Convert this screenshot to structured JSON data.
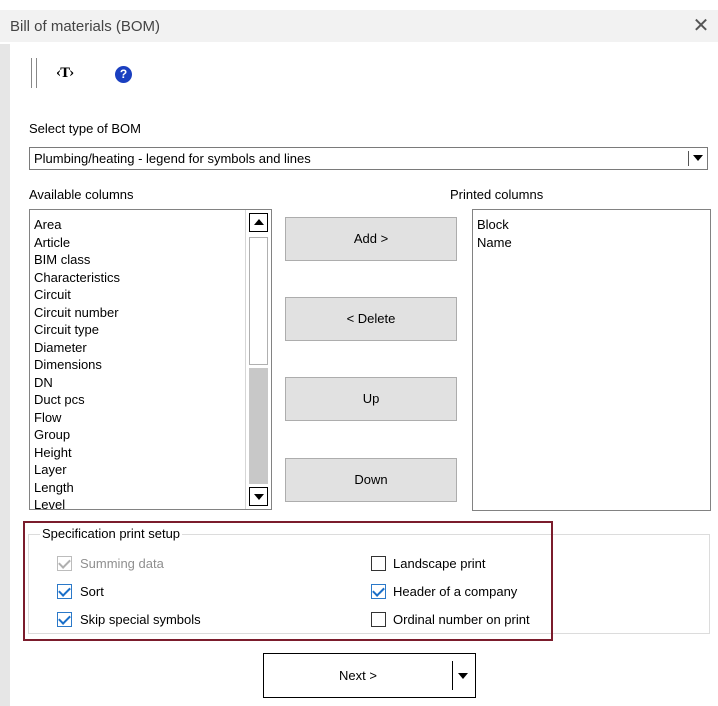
{
  "window": {
    "title": "Bill of materials (BOM)",
    "close_glyph": "✕"
  },
  "toolbar": {
    "text_tool_label": "‹T›",
    "help_glyph": "?",
    "icons": [
      "toolbar-grip",
      "text-tool-icon",
      "help-icon"
    ]
  },
  "bom_type": {
    "label": "Select type of BOM",
    "selected": "Plumbing/heating - legend for symbols and lines"
  },
  "available": {
    "label": "Available columns",
    "items": [
      "Area",
      "Article",
      "BIM class",
      "Characteristics",
      "Circuit",
      "Circuit number",
      "Circuit type",
      "Diameter",
      "Dimensions",
      "DN",
      "Duct pcs",
      "Flow",
      "Group",
      "Height",
      "Layer",
      "Length",
      "Level"
    ]
  },
  "buttons": {
    "add": "Add >",
    "delete": "< Delete",
    "up": "Up",
    "down": "Down",
    "next": "Next >"
  },
  "printed": {
    "label": "Printed columns",
    "items": [
      "Block",
      "Name"
    ]
  },
  "print_setup": {
    "label": "Specification print setup",
    "options": [
      {
        "label": "Summing data",
        "checked": true,
        "disabled": true
      },
      {
        "label": "Sort",
        "checked": true,
        "disabled": false
      },
      {
        "label": "Skip special symbols",
        "checked": true,
        "disabled": false
      },
      {
        "label": "Landscape print",
        "checked": false,
        "disabled": false
      },
      {
        "label": "Header of a company",
        "checked": true,
        "disabled": false
      },
      {
        "label": "Ordinal number on print",
        "checked": false,
        "disabled": false
      }
    ]
  },
  "colors": {
    "accent": "#1a6fc9",
    "highlight_border": "#7b1c2c",
    "button_face": "#e1e1e1",
    "help_icon": "#1a3fc0"
  }
}
